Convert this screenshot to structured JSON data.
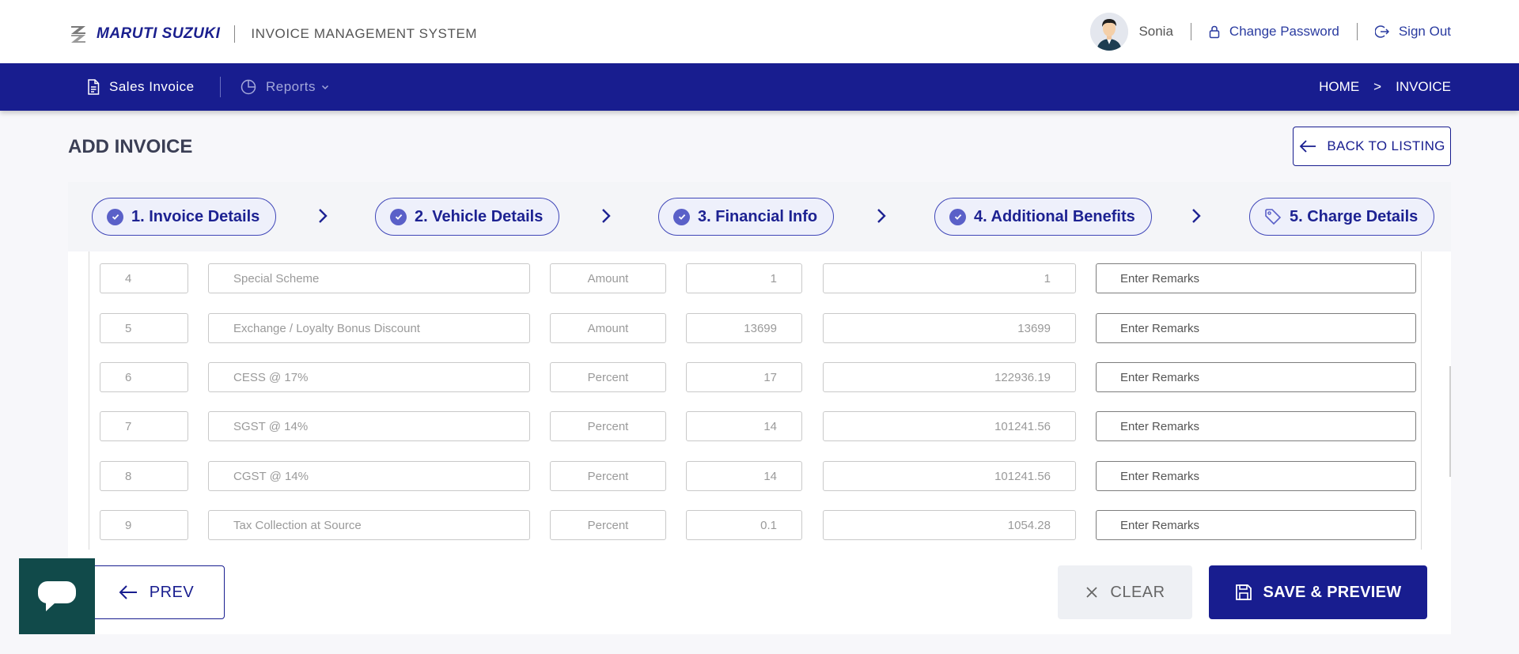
{
  "header": {
    "brand": "MARUTI SUZUKI",
    "app_title": "INVOICE MANAGEMENT SYSTEM",
    "user_name": "Sonia",
    "change_password": "Change Password",
    "sign_out": "Sign Out"
  },
  "nav": {
    "sales_invoice": "Sales Invoice",
    "reports": "Reports",
    "breadcrumb": {
      "home": "HOME",
      "separator": ">",
      "current": "INVOICE"
    }
  },
  "page": {
    "title": "ADD INVOICE",
    "back_label": "BACK TO LISTING"
  },
  "steps": [
    {
      "label": "1. Invoice Details",
      "completed": true
    },
    {
      "label": "2. Vehicle Details",
      "completed": true
    },
    {
      "label": "3. Financial Info",
      "completed": true
    },
    {
      "label": "4. Additional Benefits",
      "completed": true
    },
    {
      "label": "5. Charge Details",
      "completed": false
    }
  ],
  "charges": [
    {
      "no": "4",
      "desc": "Special Scheme",
      "type": "Amount",
      "rate": "1",
      "amount": "1",
      "remarks_placeholder": "Enter Remarks"
    },
    {
      "no": "5",
      "desc": "Exchange / Loyalty Bonus Discount",
      "type": "Amount",
      "rate": "13699",
      "amount": "13699",
      "remarks_placeholder": "Enter Remarks"
    },
    {
      "no": "6",
      "desc": "CESS @ 17%",
      "type": "Percent",
      "rate": "17",
      "amount": "122936.19",
      "remarks_placeholder": "Enter Remarks"
    },
    {
      "no": "7",
      "desc": "SGST @ 14%",
      "type": "Percent",
      "rate": "14",
      "amount": "101241.56",
      "remarks_placeholder": "Enter Remarks"
    },
    {
      "no": "8",
      "desc": "CGST @ 14%",
      "type": "Percent",
      "rate": "14",
      "amount": "101241.56",
      "remarks_placeholder": "Enter Remarks"
    },
    {
      "no": "9",
      "desc": "Tax Collection at Source",
      "type": "Percent",
      "rate": "0.1",
      "amount": "1054.28",
      "remarks_placeholder": "Enter Remarks"
    }
  ],
  "actions": {
    "prev": "PREV",
    "clear": "CLEAR",
    "save": "SAVE & PREVIEW"
  },
  "colors": {
    "primary": "#181d8f",
    "chat_widget": "#114a4a"
  }
}
